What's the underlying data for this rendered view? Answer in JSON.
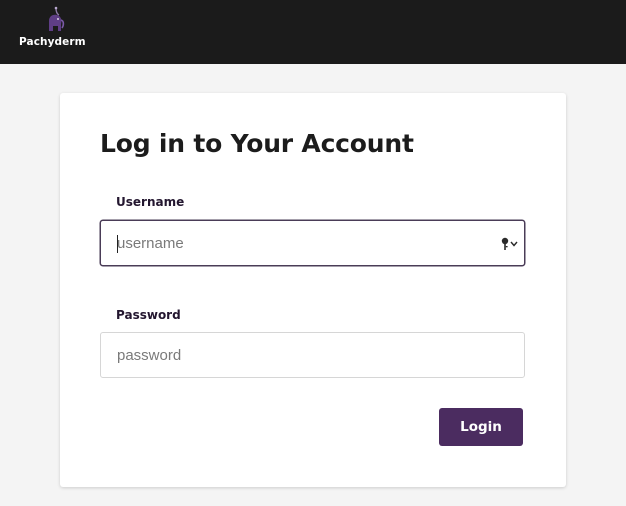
{
  "header": {
    "brand_name": "Pachyderm",
    "logo_icon": "pachyderm-elephant-icon",
    "background_color": "#1b1b1b"
  },
  "login_form": {
    "title": "Log in to Your Account",
    "username": {
      "label": "Username",
      "placeholder": "username",
      "value": "",
      "focused": true,
      "autofill_icon": "key-dropdown-icon"
    },
    "password": {
      "label": "Password",
      "placeholder": "password",
      "value": ""
    },
    "submit_label": "Login"
  },
  "colors": {
    "page_background": "#f4f4f4",
    "accent": "#4b2c60",
    "focused_border": "#4a3c57"
  }
}
